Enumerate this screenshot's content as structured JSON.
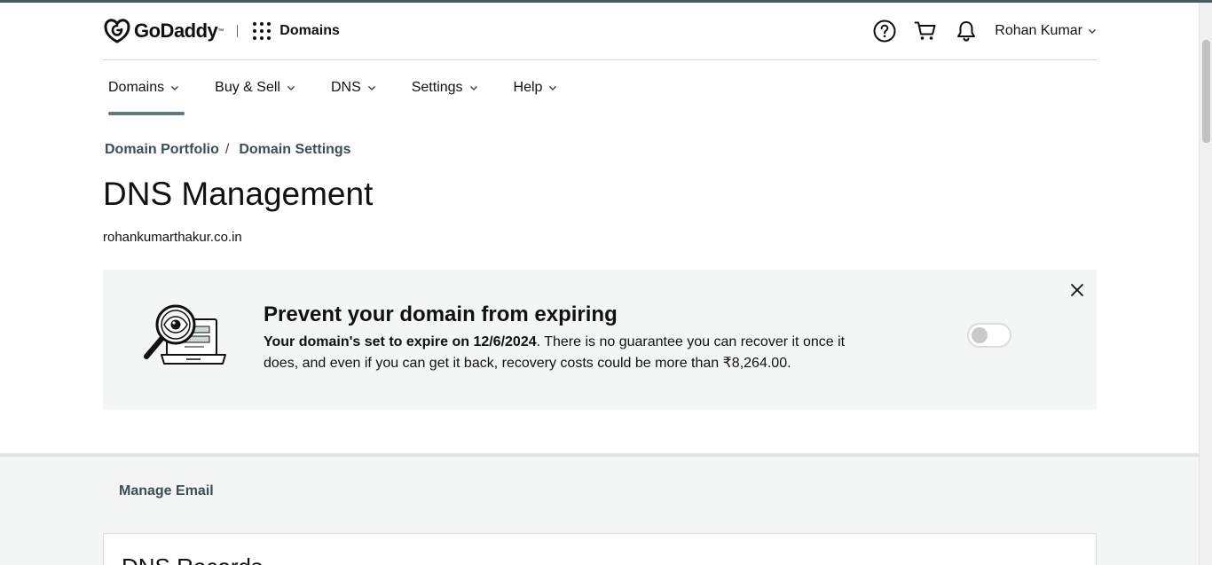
{
  "header": {
    "logo_text": "GoDaddy",
    "apps_label": "Domains",
    "icons": [
      "help-icon",
      "cart-icon",
      "bell-icon"
    ],
    "user_name": "Rohan Kumar"
  },
  "nav": {
    "items": [
      {
        "label": "Domains",
        "active": true
      },
      {
        "label": "Buy & Sell",
        "active": false
      },
      {
        "label": "DNS",
        "active": false
      },
      {
        "label": "Settings",
        "active": false
      },
      {
        "label": "Help",
        "active": false
      }
    ]
  },
  "breadcrumb": {
    "items": [
      "Domain Portfolio",
      "Domain Settings"
    ],
    "separator": "/"
  },
  "page": {
    "title": "DNS Management",
    "domain": "rohankumarthakur.co.in"
  },
  "banner": {
    "title": "Prevent your domain from expiring",
    "bold_text": "Your domain's set to expire on 12/6/2024",
    "text": ". There is no guarantee you can recover it once it does, and even if you can get it back, recovery costs could be more than ₹8,264.00.",
    "auto_renew_on": false
  },
  "lower": {
    "manage_email": "Manage Email",
    "records_title": "DNS Records"
  },
  "colors": {
    "accent": "#5e7a7d",
    "link": "#3a4f54",
    "banner_bg": "#f4f5f5"
  }
}
